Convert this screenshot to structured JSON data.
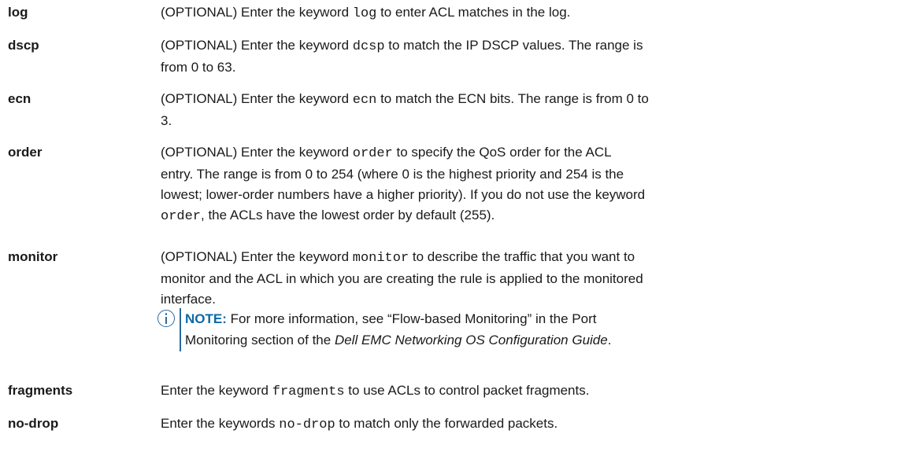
{
  "rows": [
    {
      "term": "log",
      "pre": "(OPTIONAL) Enter the keyword ",
      "kw": "log",
      "post": " to enter ACL matches in the log."
    },
    {
      "term": "dscp",
      "pre": "(OPTIONAL) Enter the keyword ",
      "kw": "dcsp",
      "post_line1": " to match the IP DSCP values. The range is",
      "post_line2": "from 0 to 63."
    },
    {
      "term": "ecn",
      "pre": "(OPTIONAL) Enter the keyword ",
      "kw": "ecn",
      "post_line1": " to match the ECN bits. The range is from 0 to",
      "post_line2": "3."
    },
    {
      "term": "order",
      "pre": "(OPTIONAL) Enter the keyword ",
      "kw": "order",
      "post_line1": " to specify the QoS order for the ACL",
      "line2": "entry. The range is from 0 to 254 (where 0 is the highest priority and 254 is the",
      "line3": "lowest; lower-order numbers have a higher priority). If you do not use the keyword",
      "kw2": "order",
      "line4": ", the ACLs have the lowest order by default (255)."
    },
    {
      "term": "monitor",
      "pre": "(OPTIONAL) Enter the keyword ",
      "kw": "monitor",
      "post_line1": " to describe the traffic that you want to",
      "line2": "monitor and the ACL in which you are creating the rule is applied to the monitored",
      "line3": "interface."
    },
    {
      "term": "fragments",
      "pre": "Enter the keyword ",
      "kw": "fragments",
      "post": " to use ACLs to control packet fragments."
    },
    {
      "term": "no-drop",
      "pre": "Enter the keywords ",
      "kw": "no-drop",
      "post": " to match only the forwarded packets."
    }
  ],
  "note": {
    "label": "NOTE:",
    "line1": " For more information, see “Flow-based Monitoring” in the Port",
    "line2_pre": "Monitoring section of the ",
    "line2_ital": "Dell EMC Networking OS Configuration Guide",
    "line2_post": "."
  }
}
